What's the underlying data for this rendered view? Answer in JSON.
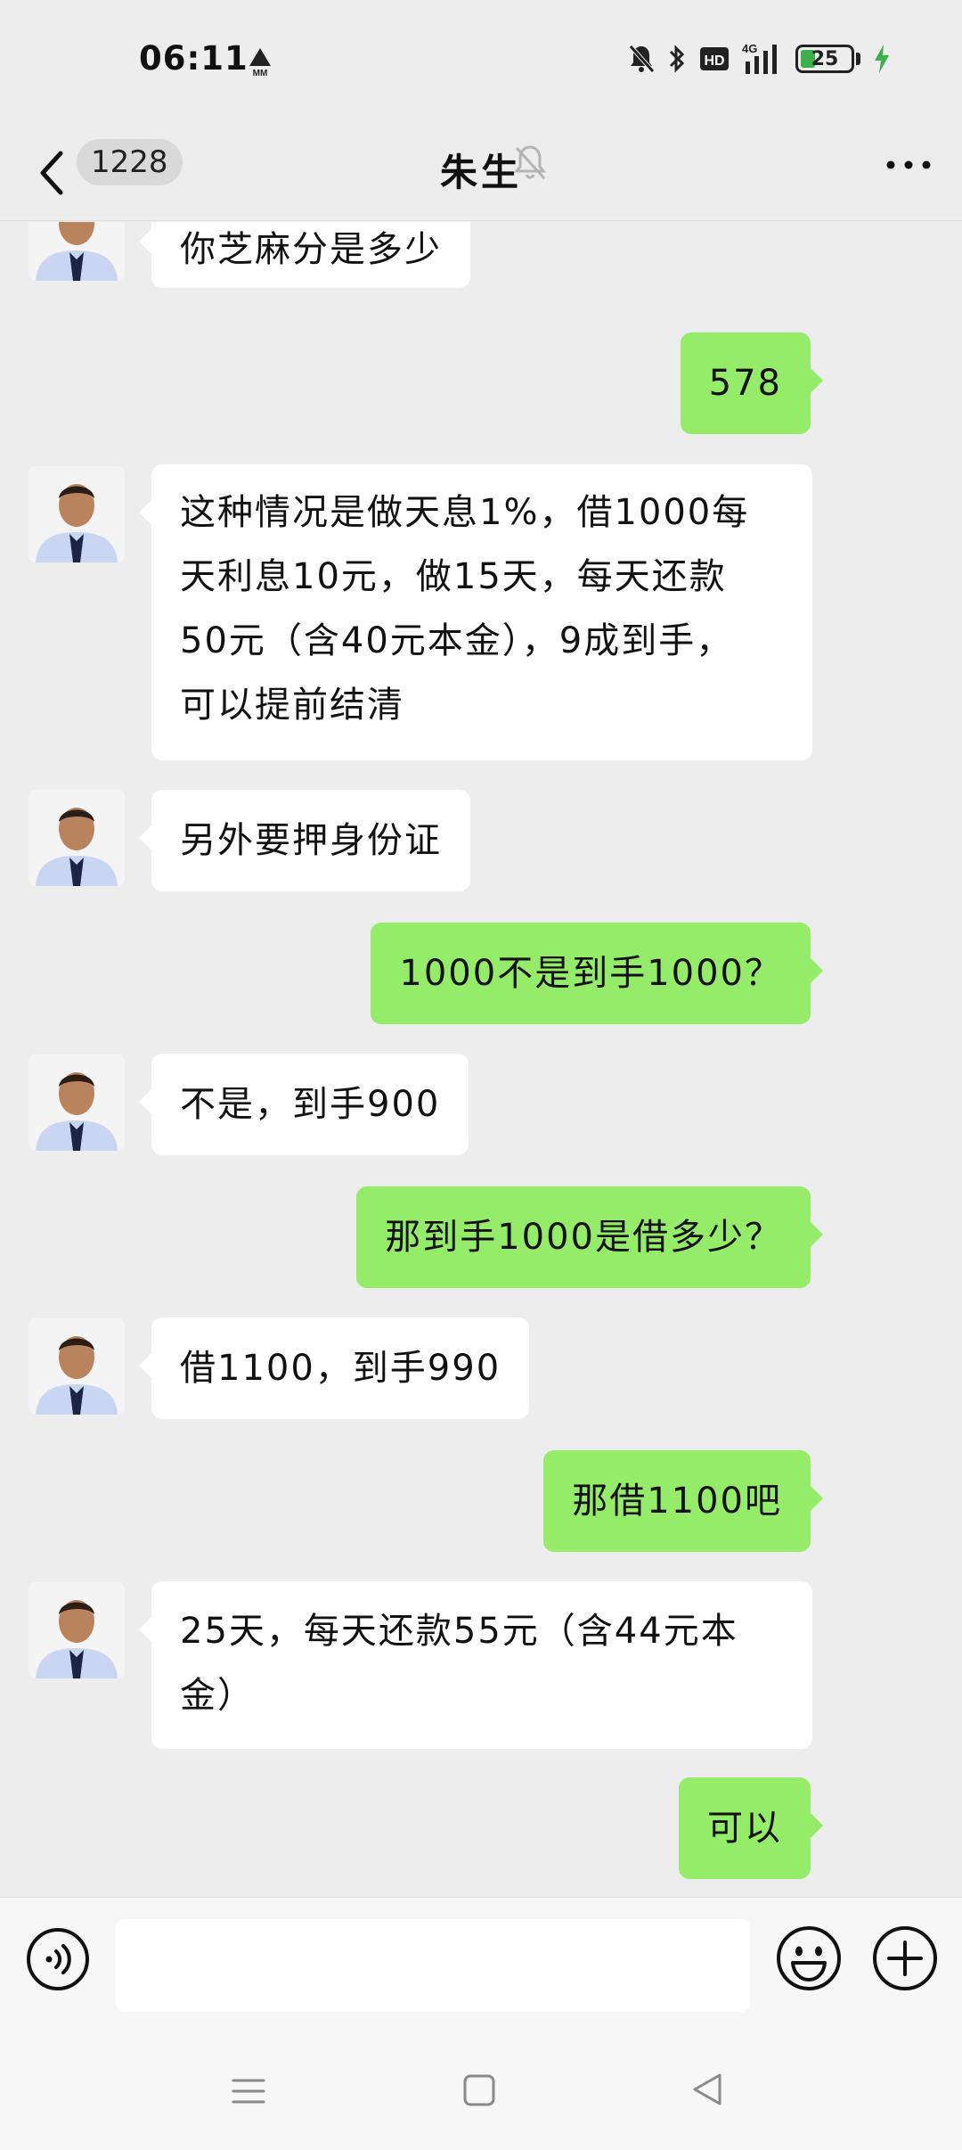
{
  "status_bar": {
    "time": "06:11",
    "battery": "25",
    "network": "4G",
    "icons": [
      "mm-alert-icon",
      "mute-bell-icon",
      "bluetooth-icon",
      "hd-icon",
      "signal-4g-icon",
      "battery-icon",
      "charging-icon"
    ]
  },
  "nav": {
    "unread_count": "1228",
    "title": "朱生"
  },
  "messages": [
    {
      "side": "in",
      "text": "你芝麻分是多少"
    },
    {
      "side": "out",
      "text": "578"
    },
    {
      "side": "in",
      "lines": [
        "这种情况是做天息1%，借1000每",
        "天利息10元，做15天，每天还款",
        "50元（含40元本金），9成到手，",
        "可以提前结清"
      ]
    },
    {
      "side": "in",
      "text": "另外要押身份证"
    },
    {
      "side": "out",
      "text": "1000不是到手1000？"
    },
    {
      "side": "in",
      "text": "不是，到手900"
    },
    {
      "side": "out",
      "text": "那到手1000是借多少？"
    },
    {
      "side": "in",
      "text": "借1100，到手990"
    },
    {
      "side": "out",
      "text": "那借1100吧"
    },
    {
      "side": "in",
      "lines": [
        "25天，每天还款55元（含44元本",
        "金）"
      ]
    },
    {
      "side": "out",
      "text": "可以"
    }
  ],
  "input": {
    "placeholder": ""
  },
  "colors": {
    "background": "#ededed",
    "incoming_bubble": "#ffffff",
    "outgoing_bubble": "#95ec69"
  }
}
